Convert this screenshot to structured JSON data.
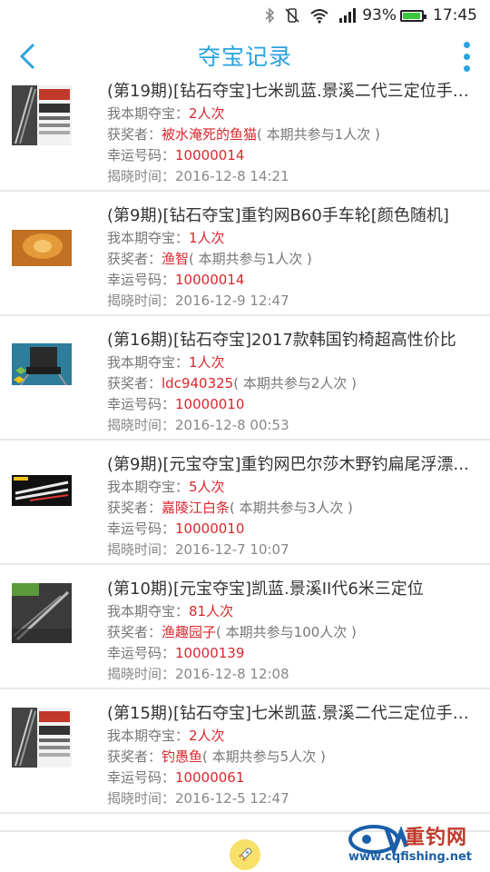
{
  "status_bar": {
    "battery": "93%",
    "battery_level": 0.93,
    "time": "17:45",
    "icons": [
      "bluetooth-icon",
      "vibrate-icon",
      "wifi-icon",
      "signal-icon",
      "battery-icon"
    ]
  },
  "header": {
    "title": "夺宝记录",
    "back_icon": "back-chevron-icon",
    "more_icon": "more-vertical-icon"
  },
  "labels": {
    "participation": "我本期夺宝：",
    "winner": "获奖者：",
    "lucky_code": "幸运号码：",
    "reveal_time": "揭晓时间："
  },
  "records": [
    {
      "title": "(第19期)[钻石夺宝]七米凯蓝.景溪二代三定位手车...",
      "times": "2人次",
      "winner": "被水淹死的鱼猫",
      "total": "( 本期共参与1人次 )",
      "code": "10000014",
      "time": "2016-12-8 14:21",
      "thumb": "rod-box"
    },
    {
      "title": "(第9期)[钻石夺宝]重钓网B60手车轮[颜色随机]",
      "times": "1人次",
      "winner": "渔智",
      "total": "( 本期共参与1人次 )",
      "code": "10000014",
      "time": "2016-12-9 12:47",
      "thumb": "reel"
    },
    {
      "title": "(第16期)[钻石夺宝]2017款韩国钓椅超高性价比",
      "times": "1人次",
      "winner": "ldc940325",
      "total": "( 本期共参与2人次 )",
      "code": "10000010",
      "time": "2016-12-8 00:53",
      "thumb": "chair"
    },
    {
      "title": "(第9期)[元宝夺宝]重钓网巴尔莎木野钓扁尾浮漂...",
      "times": "5人次",
      "winner": "嘉陵江白条",
      "total": "( 本期共参与3人次 )",
      "code": "10000010",
      "time": "2016-12-7 10:07",
      "thumb": "floats"
    },
    {
      "title": "(第10期)[元宝夺宝]凯蓝.景溪II代6米三定位",
      "times": "81人次",
      "winner": "渔趣园子",
      "total": "( 本期共参与100人次 )",
      "code": "10000139",
      "time": "2016-12-8 12:08",
      "thumb": "rod-green"
    },
    {
      "title": "(第15期)[钻石夺宝]七米凯蓝.景溪二代三定位手车...",
      "times": "2人次",
      "winner": "钓愚鱼",
      "total": "( 本期共参与5人次 )",
      "code": "10000061",
      "time": "2016-12-5 12:47",
      "thumb": "rod-box"
    }
  ],
  "bottom": {
    "fab_icon": "rocket-icon"
  },
  "watermark": {
    "cn": "重钓网",
    "url": "www.cqfishing.net"
  },
  "colors": {
    "accent": "#2aa3df",
    "highlight": "#d9272e",
    "muted": "#888888"
  }
}
